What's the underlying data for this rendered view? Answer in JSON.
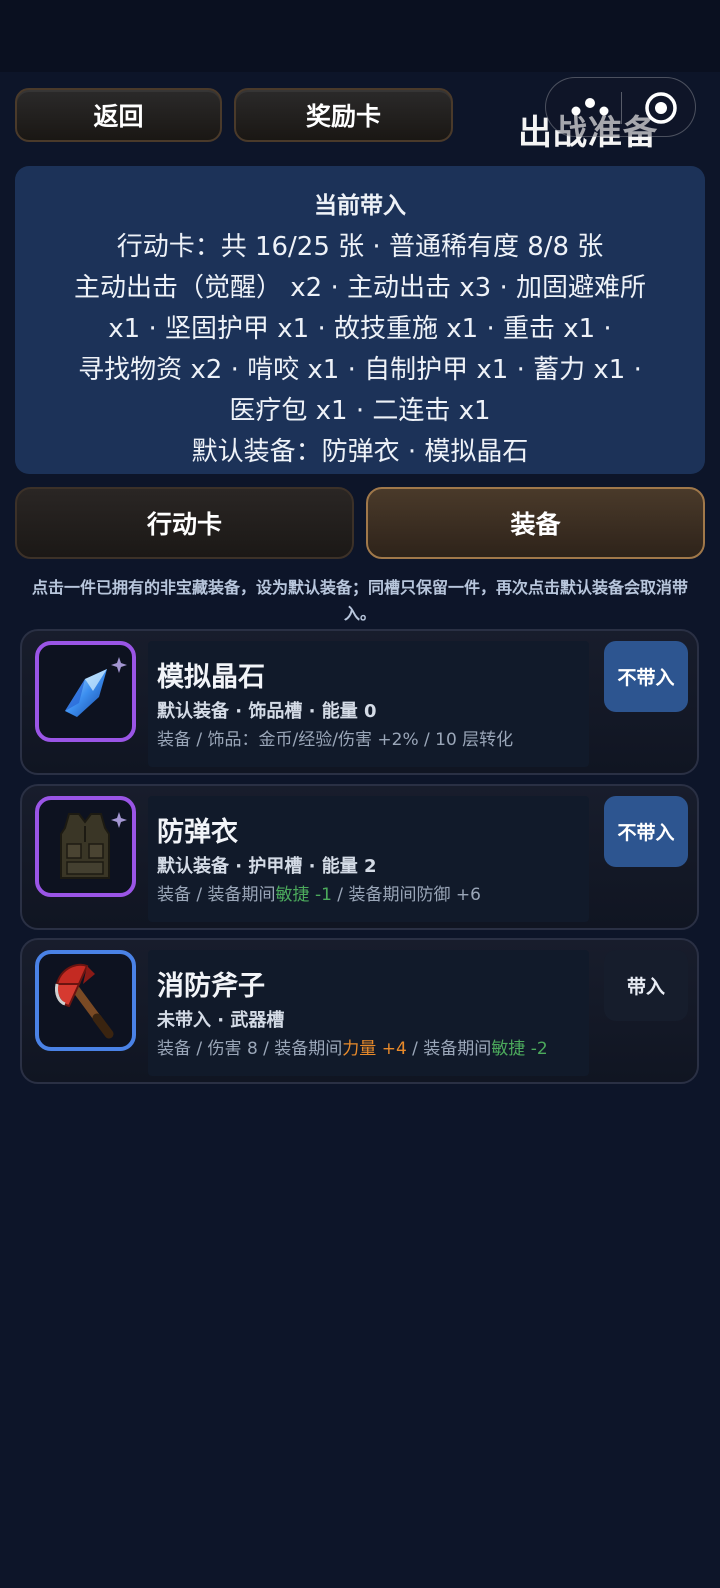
{
  "header": {
    "back_label": "返回",
    "reward_label": "奖励卡",
    "title": "出战准备"
  },
  "summary": {
    "title": "当前带入",
    "lines": [
      "行动卡：共 16/25 张 · 普通稀有度 8/8 张",
      "主动出击（觉醒） x2 · 主动出击 x3 · 加固避难所",
      "x1 · 坚固护甲 x1 · 故技重施 x1 · 重击 x1 ·",
      "寻找物资 x2 · 啃咬 x1 · 自制护甲 x1 · 蓄力 x1 ·",
      "医疗包 x1 · 二连击 x1",
      "默认装备：防弹衣 · 模拟晶石"
    ]
  },
  "tabs": {
    "action_label": "行动卡",
    "equip_label": "装备"
  },
  "hint": "点击一件已拥有的非宝藏装备，设为默认装备；同槽只保留一件，再次点击默认装备会取消带入。",
  "items": [
    {
      "name": "模拟晶石",
      "meta": "默认装备 · 饰品槽 · 能量 0",
      "desc_a": "装备 / 饰品：金币/经验/伤害 +2% / 10 层转化",
      "action": "不带入",
      "icon": "crystal-icon",
      "frame_color": "#9a55e6"
    },
    {
      "name": "防弹衣",
      "meta": "默认装备 · 护甲槽 · 能量 2",
      "desc_a": "装备 / 装备期间",
      "desc_b": "敏捷 -1",
      "desc_c": " / 装备期间防御 +6",
      "action": "不带入",
      "icon": "vest-icon",
      "frame_color": "#9a55e6"
    },
    {
      "name": "消防斧子",
      "meta": "未带入 · 武器槽",
      "desc_a": "装备 / 伤害 8 / 装备期间",
      "desc_b": "力量 +4",
      "desc_c": " / 装备期间",
      "desc_d": "敏捷 -2",
      "action": "带入",
      "icon": "axe-icon",
      "frame_color": "#4a82e6"
    }
  ],
  "colors": {
    "background": "#0d1529",
    "panel": "#1c3258",
    "positive": "#4caa5c",
    "bonus": "#e88a2a"
  }
}
